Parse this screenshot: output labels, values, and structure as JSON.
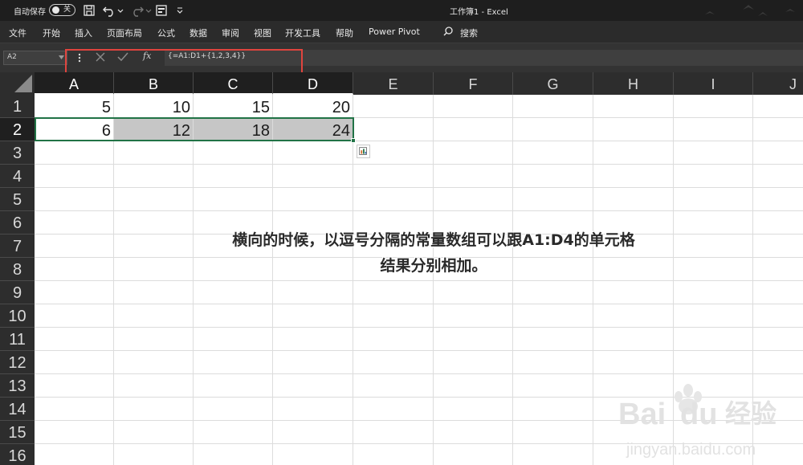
{
  "titlebar": {
    "autosave_label": "自动保存",
    "autosave_state": "关",
    "window_title": "工作簿1  -  Excel"
  },
  "menu": {
    "items": [
      "文件",
      "开始",
      "插入",
      "页面布局",
      "公式",
      "数据",
      "审阅",
      "视图",
      "开发工具",
      "帮助",
      "Power Pivot"
    ],
    "search_label": "搜索"
  },
  "formula_bar": {
    "name_box": "A2",
    "formula": "{=A1:D1+{1,2,3,4}}"
  },
  "sheet": {
    "columns": [
      "A",
      "B",
      "C",
      "D",
      "E",
      "F",
      "G",
      "H",
      "I",
      "J"
    ],
    "rows": [
      "1",
      "2",
      "3",
      "4",
      "5",
      "6",
      "7",
      "8",
      "9",
      "10",
      "11",
      "12",
      "13",
      "14",
      "15",
      "16"
    ],
    "cells": {
      "row1": [
        "5",
        "10",
        "15",
        "20"
      ],
      "row2": [
        "6",
        "12",
        "18",
        "24"
      ]
    },
    "active_cell": "A2"
  },
  "annotation": {
    "line1": "横向的时候，以逗号分隔的常量数组可以跟A1:D4的单元格",
    "line2": "结果分别相加。"
  },
  "watermark": {
    "brand": "Bai",
    "brand2": "du",
    "brand_cn": "经验",
    "url": "jingyan.baidu.com"
  },
  "colors": {
    "accent_green": "#217346",
    "highlight_red": "#e0443e",
    "shaded_cell": "#c6c6c6"
  },
  "icons": [
    "save-icon",
    "undo-icon",
    "redo-icon",
    "form-icon",
    "customize-icon",
    "search-icon",
    "cancel-icon",
    "enter-icon",
    "fx-icon",
    "quick-analysis-icon"
  ]
}
